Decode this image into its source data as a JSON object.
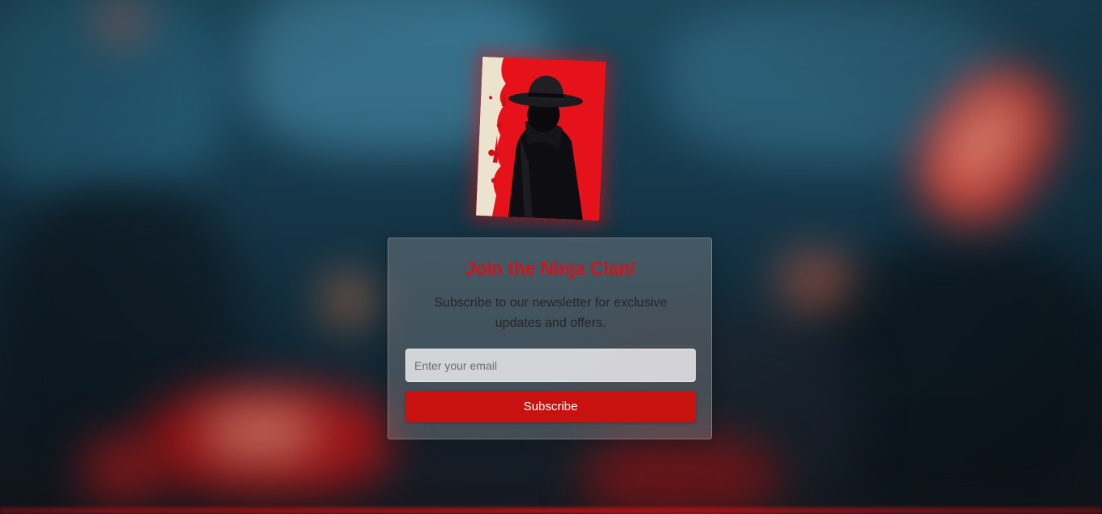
{
  "newsletter": {
    "title": "Join the Ninja Clan!",
    "description": "Subscribe to our newsletter for exclusive updates and offers.",
    "email_placeholder": "Enter your email",
    "email_value": "",
    "subscribe_label": "Subscribe"
  },
  "colors": {
    "accent": "#d4121a",
    "button": "#c8120f",
    "glow": "#e11a1a"
  },
  "poster": {
    "subject": "hooded figure with brimmed hat on red background with paint splatter"
  }
}
